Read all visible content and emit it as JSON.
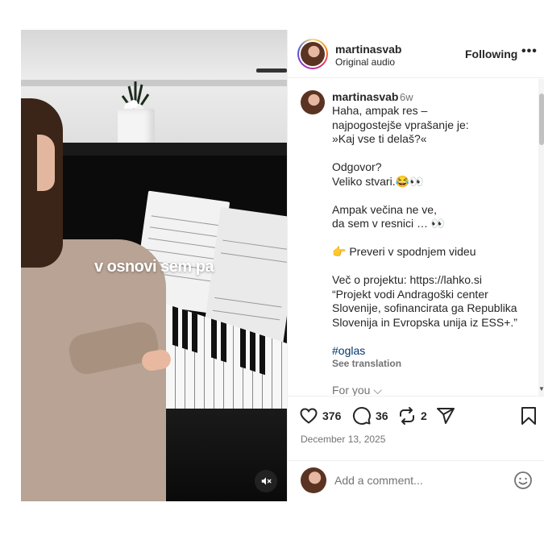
{
  "video": {
    "caption": "v osnovi sem pa",
    "mute_icon": "speaker-muted-icon"
  },
  "header": {
    "username": "martinasvab",
    "subtitle": "Original audio",
    "follow_label": "Following",
    "more_label": "•••"
  },
  "comment": {
    "username": "martinasvab",
    "time": "6w",
    "lines": [
      "Haha, ampak res –\nnajpogostejše vprašanje je:\n»Kaj vse ti delaš?«",
      "Odgovor?\nVeliko stvari.😂👀",
      "Ampak večina ne ve,\nda sem v resnici … 👀",
      "👉 Preveri v spodnjem videu",
      "Več o projektu: https://lahko.si\n“Projekt vodi Andragoški center Slovenije, sofinancirata ga Republika Slovenija in Evropska unija iz ESS+.”"
    ],
    "hashtag": "#oglas",
    "see_translation": "See translation",
    "for_you": "For you ⌵"
  },
  "actions": {
    "likes": "376",
    "comments": "36",
    "reposts": "2",
    "date": "December 13, 2025"
  },
  "comment_input": {
    "placeholder": "Add a comment..."
  }
}
